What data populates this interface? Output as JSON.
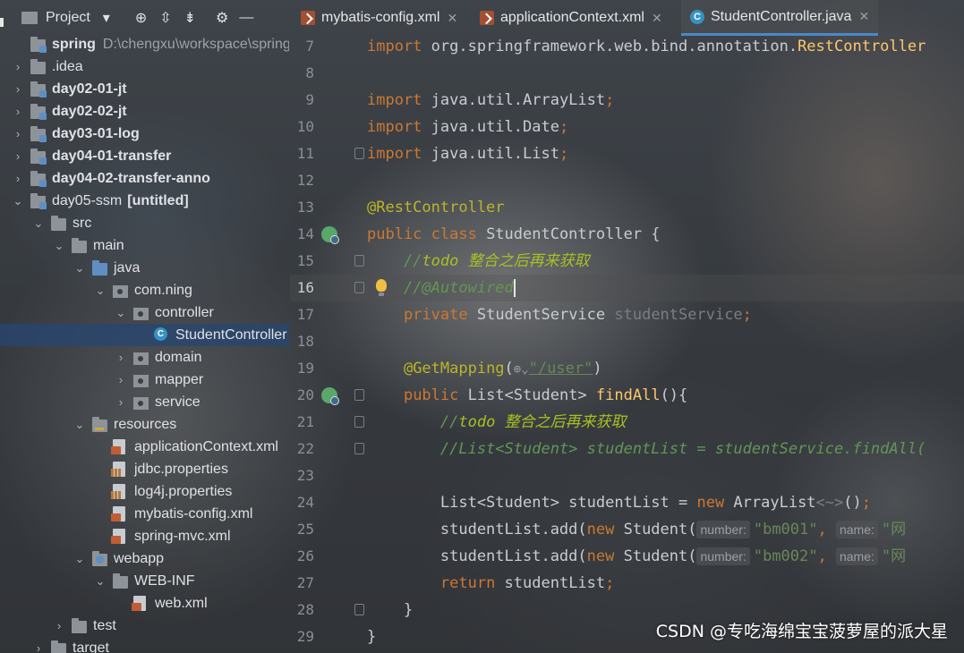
{
  "project_toolbar": {
    "title": "Project",
    "dropdown_icon": "▾",
    "icons": [
      "crosshair-icon",
      "expand-all-icon",
      "collapse-all-icon",
      "gear-icon",
      "minimize-icon"
    ]
  },
  "tabs": [
    {
      "label": "mybatis-config.xml",
      "icon": "xml-file-icon",
      "active": false
    },
    {
      "label": "applicationContext.xml",
      "icon": "xml-file-icon",
      "active": false
    },
    {
      "label": "StudentController.java",
      "icon": "java-class-icon",
      "active": true
    }
  ],
  "tree": [
    {
      "depth": 0,
      "name": "spring",
      "path": "D:\\chengxu\\workspace\\spring",
      "bold": true,
      "chevron": "",
      "icon": "module-folder"
    },
    {
      "depth": 0,
      "name": ".idea",
      "bold": false,
      "chevron": "›",
      "icon": "folder"
    },
    {
      "depth": 0,
      "name": "day02-01-jt",
      "bold": true,
      "chevron": "›",
      "icon": "module-folder"
    },
    {
      "depth": 0,
      "name": "day02-02-jt",
      "bold": true,
      "chevron": "›",
      "icon": "module-folder"
    },
    {
      "depth": 0,
      "name": "day03-01-log",
      "bold": true,
      "chevron": "›",
      "icon": "module-folder"
    },
    {
      "depth": 0,
      "name": "day04-01-transfer",
      "bold": true,
      "chevron": "›",
      "icon": "module-folder"
    },
    {
      "depth": 0,
      "name": "day04-02-transfer-anno",
      "bold": true,
      "chevron": "›",
      "icon": "module-folder"
    },
    {
      "depth": 0,
      "name": "day05-ssm",
      "suffix": "[untitled]",
      "bold": false,
      "chevron": "⌄",
      "icon": "module-folder"
    },
    {
      "depth": 1,
      "name": "src",
      "bold": false,
      "chevron": "⌄",
      "icon": "folder"
    },
    {
      "depth": 2,
      "name": "main",
      "bold": false,
      "chevron": "⌄",
      "icon": "folder"
    },
    {
      "depth": 3,
      "name": "java",
      "bold": false,
      "chevron": "⌄",
      "icon": "source-folder"
    },
    {
      "depth": 4,
      "name": "com.ning",
      "bold": false,
      "chevron": "⌄",
      "icon": "package"
    },
    {
      "depth": 5,
      "name": "controller",
      "bold": false,
      "chevron": "⌄",
      "icon": "package"
    },
    {
      "depth": 6,
      "name": "StudentController",
      "bold": false,
      "chevron": "",
      "icon": "java-class",
      "selected": true
    },
    {
      "depth": 5,
      "name": "domain",
      "bold": false,
      "chevron": "›",
      "icon": "package"
    },
    {
      "depth": 5,
      "name": "mapper",
      "bold": false,
      "chevron": "›",
      "icon": "package"
    },
    {
      "depth": 5,
      "name": "service",
      "bold": false,
      "chevron": "›",
      "icon": "package"
    },
    {
      "depth": 3,
      "name": "resources",
      "bold": false,
      "chevron": "⌄",
      "icon": "resources-folder"
    },
    {
      "depth": 4,
      "name": "applicationContext.xml",
      "bold": false,
      "chevron": "",
      "icon": "xml-file"
    },
    {
      "depth": 4,
      "name": "jdbc.properties",
      "bold": false,
      "chevron": "",
      "icon": "properties-file"
    },
    {
      "depth": 4,
      "name": "log4j.properties",
      "bold": false,
      "chevron": "",
      "icon": "properties-file"
    },
    {
      "depth": 4,
      "name": "mybatis-config.xml",
      "bold": false,
      "chevron": "",
      "icon": "xml-file"
    },
    {
      "depth": 4,
      "name": "spring-mvc.xml",
      "bold": false,
      "chevron": "",
      "icon": "xml-file"
    },
    {
      "depth": 3,
      "name": "webapp",
      "bold": false,
      "chevron": "⌄",
      "icon": "web-folder"
    },
    {
      "depth": 4,
      "name": "WEB-INF",
      "bold": false,
      "chevron": "⌄",
      "icon": "folder"
    },
    {
      "depth": 5,
      "name": "web.xml",
      "bold": false,
      "chevron": "",
      "icon": "xml-file"
    },
    {
      "depth": 2,
      "name": "test",
      "bold": false,
      "chevron": "›",
      "icon": "folder"
    },
    {
      "depth": 1,
      "name": "target",
      "bold": false,
      "chevron": "›",
      "icon": "folder"
    }
  ],
  "editor": {
    "current_line": 16,
    "lines": [
      {
        "n": 7,
        "tokens": [
          [
            "kw",
            "import "
          ],
          [
            "",
            "org.springframework.web.bind.annotation."
          ],
          [
            "fn",
            "RestController"
          ]
        ]
      },
      {
        "n": 8,
        "tokens": []
      },
      {
        "n": 9,
        "tokens": [
          [
            "kw",
            "import "
          ],
          [
            "",
            "java.util.ArrayList"
          ],
          [
            "kw",
            ";"
          ]
        ]
      },
      {
        "n": 10,
        "tokens": [
          [
            "kw",
            "import "
          ],
          [
            "",
            "java.util.Date"
          ],
          [
            "kw",
            ";"
          ]
        ]
      },
      {
        "n": 11,
        "tokens": [
          [
            "kw",
            "import "
          ],
          [
            "",
            "java.util.List"
          ],
          [
            "kw",
            ";"
          ]
        ],
        "fold": true
      },
      {
        "n": 12,
        "tokens": []
      },
      {
        "n": 13,
        "tokens": [
          [
            "ann",
            "@RestController"
          ]
        ]
      },
      {
        "n": 14,
        "tokens": [
          [
            "kw",
            "public class "
          ],
          [
            "",
            "StudentController {"
          ]
        ],
        "gutter": "spring-bean-icon"
      },
      {
        "n": 15,
        "tokens": [
          [
            "",
            "    "
          ],
          [
            "cmt",
            "//"
          ],
          [
            "todo",
            "todo 整合之后再来获取"
          ]
        ],
        "fold": true
      },
      {
        "n": 16,
        "tokens": [
          [
            "",
            "    "
          ],
          [
            "cmt",
            "//@Autowired"
          ],
          [
            "caret",
            ""
          ]
        ],
        "fold": true,
        "bulb": true
      },
      {
        "n": 17,
        "tokens": [
          [
            "",
            "    "
          ],
          [
            "kw",
            "private "
          ],
          [
            "",
            "StudentService "
          ],
          [
            "grey",
            "studentService"
          ],
          [
            "kw",
            ";"
          ]
        ]
      },
      {
        "n": 18,
        "tokens": []
      },
      {
        "n": 19,
        "tokens": [
          [
            "",
            "    "
          ],
          [
            "ann",
            "@GetMapping"
          ],
          [
            "",
            "("
          ],
          [
            "globe",
            "⊕⌄"
          ],
          [
            "strl",
            "\"/user\""
          ],
          [
            "",
            ")"
          ]
        ]
      },
      {
        "n": 20,
        "tokens": [
          [
            "",
            "    "
          ],
          [
            "kw",
            "public "
          ],
          [
            "",
            "List<Student> "
          ],
          [
            "fn",
            "findAll"
          ],
          [
            "",
            "(){"
          ]
        ],
        "gutter": "spring-web-icon",
        "fold": true
      },
      {
        "n": 21,
        "tokens": [
          [
            "",
            "        "
          ],
          [
            "cmt",
            "//"
          ],
          [
            "todo",
            "todo 整合之后再来获取"
          ]
        ],
        "fold": true
      },
      {
        "n": 22,
        "tokens": [
          [
            "",
            "        "
          ],
          [
            "cmt",
            "//List<Student> studentList = studentService.findAll("
          ]
        ],
        "fold": true
      },
      {
        "n": 23,
        "tokens": []
      },
      {
        "n": 24,
        "tokens": [
          [
            "",
            "        List<Student> studentList = "
          ],
          [
            "kw",
            "new "
          ],
          [
            "",
            "ArrayList"
          ],
          [
            "grey",
            "<~>"
          ],
          [
            "",
            "()"
          ],
          [
            "kw",
            ";"
          ]
        ]
      },
      {
        "n": 25,
        "tokens": [
          [
            "",
            "        studentList.add("
          ],
          [
            "kw",
            "new "
          ],
          [
            "",
            "Student("
          ],
          [
            "hint",
            "number:"
          ],
          [
            "str",
            "\"bm001\""
          ],
          [
            "kw",
            ", "
          ],
          [
            "hint",
            "name:"
          ],
          [
            "str",
            "\"网"
          ]
        ]
      },
      {
        "n": 26,
        "tokens": [
          [
            "",
            "        studentList.add("
          ],
          [
            "kw",
            "new "
          ],
          [
            "",
            "Student("
          ],
          [
            "hint",
            "number:"
          ],
          [
            "str",
            "\"bm002\""
          ],
          [
            "kw",
            ", "
          ],
          [
            "hint",
            "name:"
          ],
          [
            "str",
            "\"网"
          ]
        ]
      },
      {
        "n": 27,
        "tokens": [
          [
            "",
            "        "
          ],
          [
            "kw",
            "return "
          ],
          [
            "",
            "studentList"
          ],
          [
            "kw",
            ";"
          ]
        ]
      },
      {
        "n": 28,
        "tokens": [
          [
            "",
            "    }"
          ]
        ],
        "fold": true
      },
      {
        "n": 29,
        "tokens": [
          [
            "",
            "}"
          ]
        ]
      }
    ]
  },
  "watermark": "CSDN @专吃海绵宝宝菠萝屋的派大星"
}
